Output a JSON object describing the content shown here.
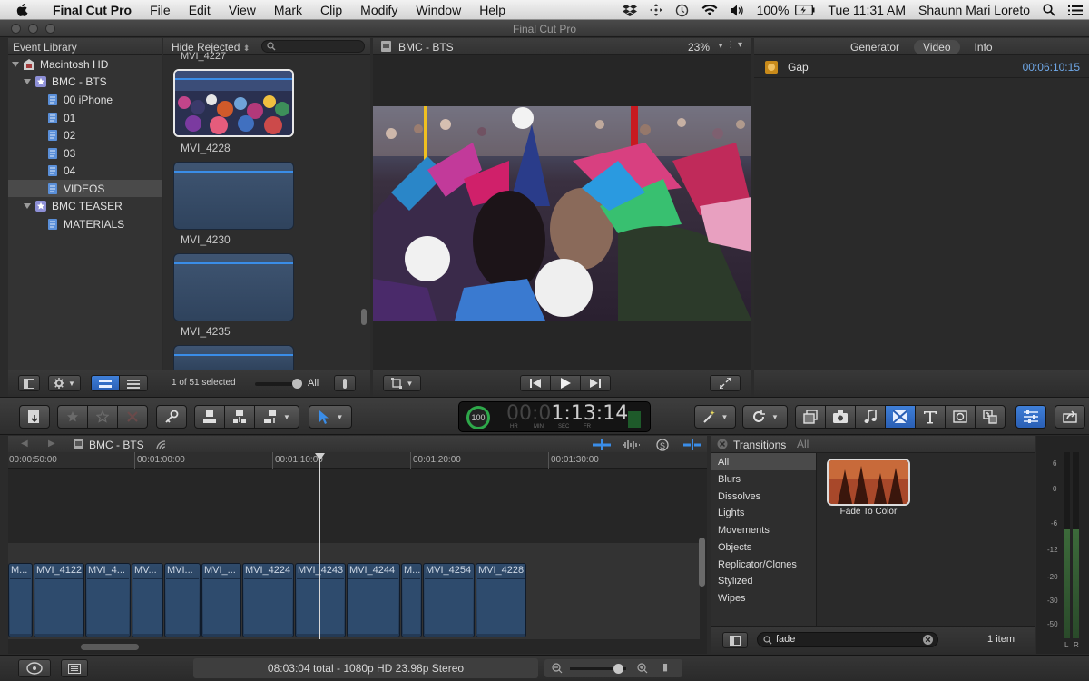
{
  "menubar": {
    "app_name": "Final Cut Pro",
    "items": [
      "File",
      "Edit",
      "View",
      "Mark",
      "Clip",
      "Modify",
      "Window",
      "Help"
    ],
    "battery": "100%",
    "clock": "Tue 11:31 AM",
    "user": "Shaunn Mari Loreto"
  },
  "window": {
    "title": "Final Cut Pro"
  },
  "library": {
    "header": "Event Library",
    "items": [
      {
        "label": "Macintosh HD"
      },
      {
        "label": "BMC - BTS"
      },
      {
        "label": "00 iPhone"
      },
      {
        "label": "01"
      },
      {
        "label": "02"
      },
      {
        "label": "03"
      },
      {
        "label": "04"
      },
      {
        "label": "VIDEOS"
      },
      {
        "label": "BMC TEASER"
      },
      {
        "label": "MATERIALS"
      }
    ],
    "footer_selected": "1 of 51 selected",
    "footer_filter": "All"
  },
  "browser": {
    "filter": "Hide Rejected",
    "clips": [
      {
        "label": "MVI_4227"
      },
      {
        "label": "MVI_4228"
      },
      {
        "label": "MVI_4230"
      },
      {
        "label": "MVI_4235"
      }
    ]
  },
  "viewer": {
    "title": "BMC - BTS",
    "zoom": "23%"
  },
  "inspector": {
    "tabs": [
      "Generator",
      "Video",
      "Info"
    ],
    "item_name": "Gap",
    "item_duration": "00:06:10:15"
  },
  "toolbar": {
    "timecode": "1:13:14",
    "timecode_dim": "00:0",
    "tc_units": [
      "HR",
      "MIN",
      "SEC",
      "FR"
    ],
    "percent": "100"
  },
  "timeline": {
    "project": "BMC - BTS",
    "ruler_labels": [
      "00:00:50:00",
      "00:01:00:00",
      "00:01:10:00",
      "00:01:20:00",
      "00:01:30:00"
    ],
    "clips": [
      "M...",
      "MVI_4122",
      "MVI_4...",
      "MV...",
      "MVI...",
      "MVI_...",
      "MVI_4224",
      "MVI_4243",
      "MVI_4244",
      "M...",
      "MVI_4254",
      "MVI_4228"
    ]
  },
  "transitions": {
    "title": "Transitions",
    "filter": "All",
    "categories": [
      "All",
      "Blurs",
      "Dissolves",
      "Lights",
      "Movements",
      "Objects",
      "Replicator/Clones",
      "Stylized",
      "Wipes"
    ],
    "item_label": "Fade To Color",
    "search_value": "fade",
    "count": "1 item"
  },
  "meters": {
    "scale": [
      "6",
      "0",
      "-6",
      "-12",
      "-20",
      "-30",
      "-50"
    ],
    "channels": [
      "L",
      "R"
    ]
  },
  "status": {
    "summary": "08:03:04 total - 1080p HD 23.98p Stereo"
  }
}
